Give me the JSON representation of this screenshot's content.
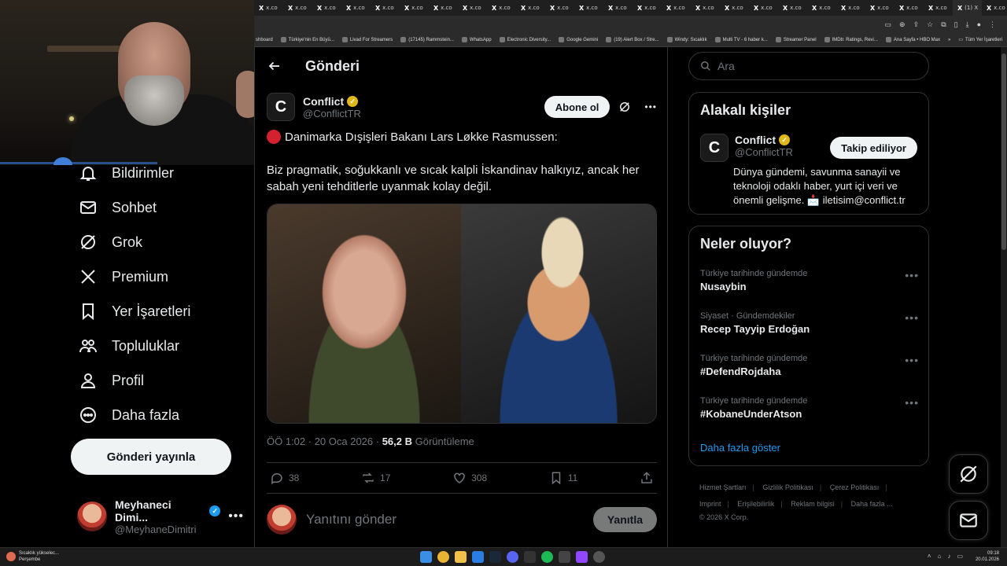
{
  "browser": {
    "tabs": [
      "x.co",
      "x.co",
      "x.co",
      "x.co",
      "x.co",
      "x.co",
      "x.co",
      "x.co",
      "x.co",
      "x.co",
      "x.co",
      "x.co",
      "x.co",
      "x.co",
      "x.co",
      "x.co",
      "x.co",
      "x.co",
      "x.co",
      "x.co",
      "x.co",
      "x.co",
      "x.co",
      "x.co",
      "(1) X",
      "x.co"
    ],
    "bookmarks": [
      "shboard",
      "Türkiye'nin En Büyü...",
      "Livad For Streamers",
      "(17145) Rammstein...",
      "WhatsApp",
      "Electronic Diversity...",
      "Google Gemini",
      "(19) Alert Box / Stre...",
      "Windy: Sıcaklık",
      "Multi TV - 6 haber k...",
      "Streamer Panel",
      "IMDb: Ratings, Revi...",
      "Ana Sayfa • HBO Max"
    ],
    "all_bookmarks": "Tüm Yer İşaretleri"
  },
  "nav": {
    "items": [
      {
        "label": "Bildirimler",
        "icon": "bell-icon"
      },
      {
        "label": "Sohbet",
        "icon": "mail-icon"
      },
      {
        "label": "Grok",
        "icon": "grok-icon"
      },
      {
        "label": "Premium",
        "icon": "x-logo-icon"
      },
      {
        "label": "Yer İşaretleri",
        "icon": "bookmark-icon"
      },
      {
        "label": "Topluluklar",
        "icon": "communities-icon"
      },
      {
        "label": "Profil",
        "icon": "profile-icon"
      },
      {
        "label": "Daha fazla",
        "icon": "more-circle-icon"
      }
    ],
    "post_button": "Gönderi yayınla",
    "account": {
      "name": "Meyhaneci Dimi...",
      "handle": "@MeyhaneDimitri"
    }
  },
  "main": {
    "title": "Gönderi",
    "author": {
      "name": "Conflict",
      "handle": "@ConflictTR",
      "subscribe": "Abone ol"
    },
    "tweet_line1": "Danimarka Dışişleri Bakanı Lars Løkke Rasmussen:",
    "tweet_line2": "Biz pragmatik, soğukkanlı ve sıcak kalpli İskandinav halkıyız, ancak her sabah yeni tehditlerle uyanmak kolay değil.",
    "meta": {
      "time": "ÖÖ 1:02 · 20 Oca 2026 · ",
      "views": "56,2 B",
      "views_label": " Görüntüleme"
    },
    "actions": {
      "replies": "38",
      "reposts": "17",
      "likes": "308",
      "bookmarks": "11"
    },
    "reply_placeholder": "Yanıtını gönder",
    "reply_button": "Yanıtla"
  },
  "right": {
    "search_placeholder": "Ara",
    "related": {
      "title": "Alakalı kişiler",
      "name": "Conflict",
      "handle": "@ConflictTR",
      "follow": "Takip ediliyor",
      "bio": "Dünya gündemi, savunma sanayii ve teknoloji odaklı haber, yurt içi veri ve önemli gelişme. 📩 iletisim@conflict.tr"
    },
    "trends": {
      "title": "Neler oluyor?",
      "items": [
        {
          "context": "Türkiye tarihinde gündemde",
          "name": "Nusaybin"
        },
        {
          "context": "Siyaset · Gündemdekiler",
          "name": "Recep Tayyip Erdoğan"
        },
        {
          "context": "Türkiye tarihinde gündemde",
          "name": "#DefendRojdaha"
        },
        {
          "context": "Türkiye tarihinde gündemde",
          "name": "#KobaneUnderAtson"
        }
      ],
      "show_more": "Daha fazla göster"
    },
    "footer": {
      "links1": [
        "Hizmet Şartları",
        "Gizlilik Politikası",
        "Çerez Politikası"
      ],
      "links2": [
        "Imprint",
        "Erişilebilirlik",
        "Reklam bilgisi",
        "Daha fazla ..."
      ],
      "copyright": "© 2026 X Corp."
    }
  },
  "taskbar": {
    "weather_line1": "Sıcaklık yükselec...",
    "weather_line2": "Perşembe",
    "time": "09:18",
    "date": "20.01.2026"
  },
  "colors": {
    "accent": "#1d9bf0",
    "gold": "#e2b719",
    "red_dot": "#d4202f"
  }
}
